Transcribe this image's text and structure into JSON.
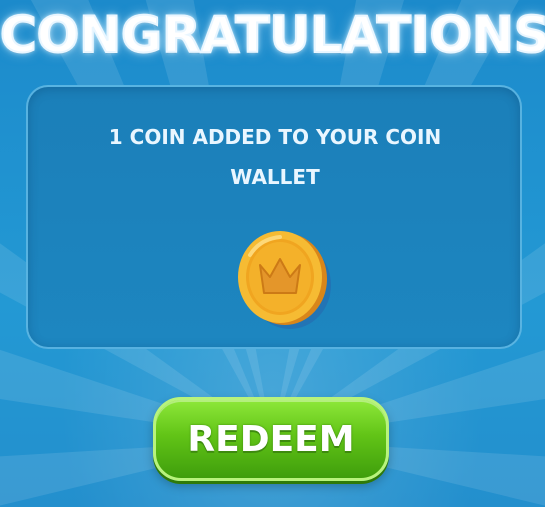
{
  "dialog": {
    "title": "CONGRATULATIONS",
    "message_line1": "1 COIN ADDED TO YOUR COIN",
    "message_line2": "WALLET",
    "coin_icon": "crown-coin-icon"
  },
  "actions": {
    "redeem_label": "REDEEM"
  },
  "colors": {
    "background": "#1f8fcb",
    "panel": "#1b7fb9",
    "button_green": "#62c417",
    "coin_gold": "#f5b731"
  }
}
